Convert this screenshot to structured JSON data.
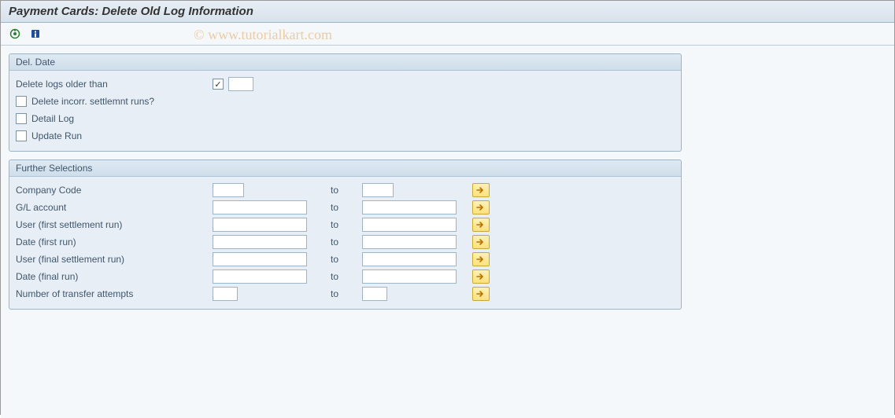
{
  "title": "Payment Cards: Delete Old Log Information",
  "watermark": "© www.tutorialkart.com",
  "group1": {
    "header": "Del. Date",
    "delete_older_label": "Delete logs older than",
    "delete_older_value": "",
    "chk_incorr_label": "Delete incorr. settlemnt runs?",
    "chk_detail_label": "Detail Log",
    "chk_update_label": "Update Run"
  },
  "group2": {
    "header": "Further Selections",
    "to_label": "to",
    "rows": [
      {
        "label": "Company Code",
        "size": "small"
      },
      {
        "label": "G/L account",
        "size": "med"
      },
      {
        "label": "User (first settlement run)",
        "size": "med"
      },
      {
        "label": "Date (first run)",
        "size": "med"
      },
      {
        "label": "User (final settlement run)",
        "size": "med"
      },
      {
        "label": "Date (final run)",
        "size": "med"
      },
      {
        "label": "Number of transfer attempts",
        "size": "narrow"
      }
    ]
  }
}
